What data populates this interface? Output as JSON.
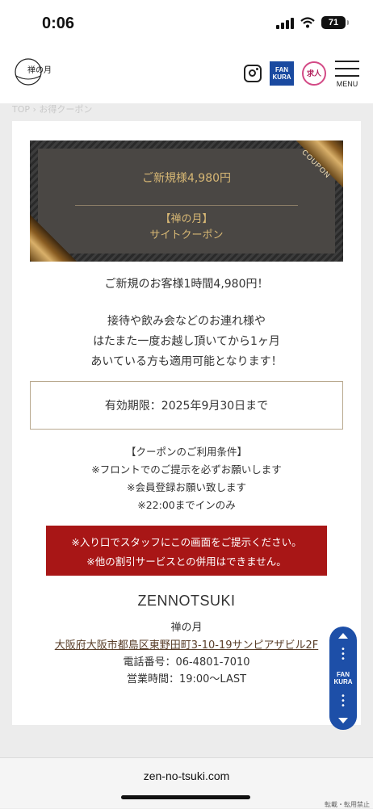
{
  "status_bar": {
    "time": "0:06",
    "battery": "71"
  },
  "header": {
    "logo_text": "禅の月",
    "fankura_line1": "FAN",
    "fankura_line2": "KURA",
    "kyujin_label": "求人",
    "menu_label": "MENU"
  },
  "breadcrumb": "TOP › お得クーポン",
  "coupon": {
    "tag": "COUPON",
    "title": "ご新規様4,980円",
    "sub1": "【禅の月】",
    "sub2": "サイトクーポン"
  },
  "headline": "ご新規のお客様1時間4,980円！",
  "description": [
    "接待や飲み会などのお連れ様や",
    "はたまた一度お越し頂いてから1ヶ月",
    "あいている方も適用可能となります！"
  ],
  "validity": "有効期限：2025年9月30日まで",
  "conditions": [
    "【クーポンのご利用条件】",
    "※フロントでのご提示を必ずお願いします",
    "※会員登録お願い致します",
    "※22:00までインのみ"
  ],
  "notice": [
    "※入り口でスタッフにこの画面をご提示ください。",
    "※他の割引サービスとの併用はできません。"
  ],
  "shop": {
    "name_en": "ZENNOTSUKI",
    "name_ja": "禅の月",
    "address": "大阪府大阪市都島区東野田町3-10-19サンピアザビル2F",
    "phone": "電話番号：06-4801-7010",
    "hours": "営業時間：19:00〜LAST"
  },
  "float_button": {
    "line1": "FAN",
    "line2": "KURA"
  },
  "url_bar": {
    "url": "zen-no-tsuki.com",
    "copy_note": "転載・転用禁止"
  },
  "colors": {
    "accent_gold": "#d8b875",
    "notice_red": "#a81616",
    "fankura_blue": "#1d4fa8"
  }
}
